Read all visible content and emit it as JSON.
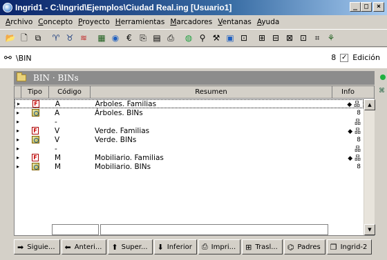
{
  "window": {
    "title": "Ingrid1 - C:\\Ingrid\\Ejemplos\\Ciudad Real.ing  [Usuario1]"
  },
  "menu": [
    "Archivo",
    "Concepto",
    "Proyecto",
    "Herramientas",
    "Marcadores",
    "Ventanas",
    "Ayuda"
  ],
  "path": {
    "text": "\\BIN",
    "count": "8",
    "edicion_label": "Edición",
    "edicion_checked": true
  },
  "group": {
    "title": "BIN · BINs"
  },
  "columns": {
    "tipo": "Tipo",
    "codigo": "Código",
    "resumen": "Resumen",
    "info": "Info"
  },
  "rows": [
    {
      "tipo": "F",
      "codigo": "A",
      "resumen": "Árboles. Familias",
      "info": "◆ 品"
    },
    {
      "tipo": "B",
      "codigo": "A",
      "resumen": "Árboles. BINs",
      "info": "8"
    },
    {
      "tipo": "",
      "codigo": "-",
      "resumen": "",
      "info": "品"
    },
    {
      "tipo": "F",
      "codigo": "V",
      "resumen": "Verde. Familias",
      "info": "◆ 品"
    },
    {
      "tipo": "B",
      "codigo": "V",
      "resumen": "Verde. BINs",
      "info": "8"
    },
    {
      "tipo": "",
      "codigo": "-",
      "resumen": "",
      "info": "品"
    },
    {
      "tipo": "F",
      "codigo": "M",
      "resumen": "Mobiliario. Familias",
      "info": "◆ 品"
    },
    {
      "tipo": "B",
      "codigo": "M",
      "resumen": "Mobiliario. BINs",
      "info": "8"
    }
  ],
  "nav": [
    {
      "label": "Siguie...",
      "icon": "➡",
      "name": "siguiente-button"
    },
    {
      "label": "Anteri...",
      "icon": "⬅",
      "name": "anterior-button"
    },
    {
      "label": "Super...",
      "icon": "⬆",
      "name": "superior-button"
    },
    {
      "label": "Inferior",
      "icon": "⬇",
      "name": "inferior-button"
    },
    {
      "label": "Impri...",
      "icon": "⎙",
      "name": "imprimir-button"
    },
    {
      "label": "Trasl...",
      "icon": "⊞",
      "name": "trasladar-button"
    },
    {
      "label": "Padres",
      "icon": "⌬",
      "name": "padres-button"
    },
    {
      "label": "Ingrid-2",
      "icon": "❐",
      "name": "ingrid2-button"
    }
  ]
}
